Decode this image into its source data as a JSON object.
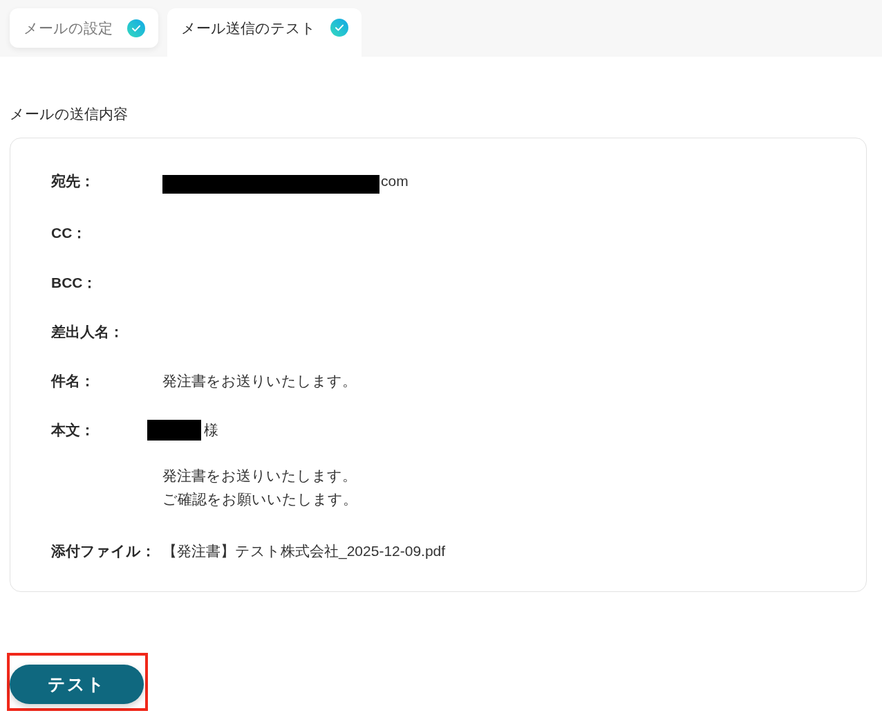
{
  "tabs": [
    {
      "label": "メールの設定",
      "selected": false,
      "completed": true
    },
    {
      "label": "メール送信のテスト",
      "selected": true,
      "completed": true
    }
  ],
  "section_title": "メールの送信内容",
  "fields": [
    {
      "kind": "text",
      "label": "宛先：",
      "value": "com",
      "redacted": true
    },
    {
      "kind": "text",
      "label": "CC：",
      "redacted": false
    },
    {
      "kind": "text",
      "label": "BCC：",
      "redacted": false
    },
    {
      "kind": "text",
      "label": "差出人名：",
      "redacted": false
    },
    {
      "kind": "text",
      "label": "件名：",
      "value": "発注書をお送りいたします。",
      "redacted": false
    },
    {
      "kind": "body",
      "label": "本文：",
      "salutation": "様",
      "redacted": true,
      "lines": [
        "発注書をお送りいたします。",
        "ご確認をお願いいたします。"
      ]
    },
    {
      "kind": "text",
      "label": "添付ファイル：",
      "value": "【発注書】テスト株式会社_2025-12-09.pdf",
      "redacted": false
    }
  ],
  "button": {
    "label": "テスト",
    "highlighted": true
  }
}
